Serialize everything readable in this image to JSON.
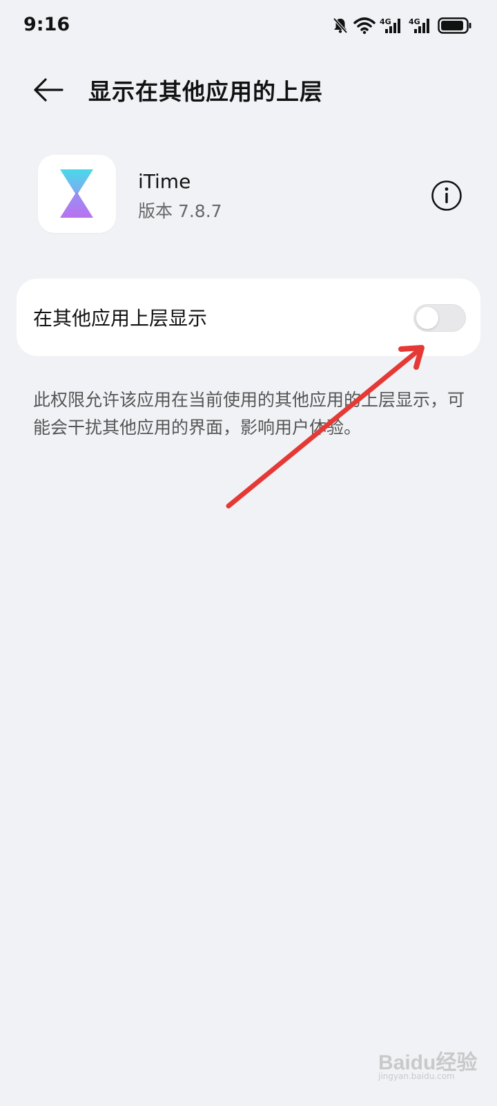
{
  "status_bar": {
    "time": "9:16",
    "icons": [
      "bell-muted-icon",
      "wifi-icon",
      "signal-4g-icon",
      "signal-4g-icon",
      "battery-icon"
    ],
    "network_label": "4G"
  },
  "header": {
    "title": "显示在其他应用的上层",
    "back_icon": "arrow-left-icon"
  },
  "app": {
    "name": "iTime",
    "version": "版本 7.8.7",
    "icon": "hourglass-icon",
    "info_icon": "info-circle-icon"
  },
  "setting": {
    "label": "在其他应用上层显示",
    "enabled": false,
    "description": "此权限允许该应用在当前使用的其他应用的上层显示，可能会干扰其他应用的界面，影响用户体验。"
  },
  "watermark": {
    "logo_text": "Baidu经验",
    "url_text": "jingyan.baidu.com"
  },
  "colors": {
    "background": "#f1f2f6",
    "card": "#ffffff",
    "toggle_off": "#e8e8ea",
    "annotation_arrow": "#e53935",
    "icon_gradient_top": "#3fd7e8",
    "icon_gradient_bottom": "#b66af0"
  }
}
